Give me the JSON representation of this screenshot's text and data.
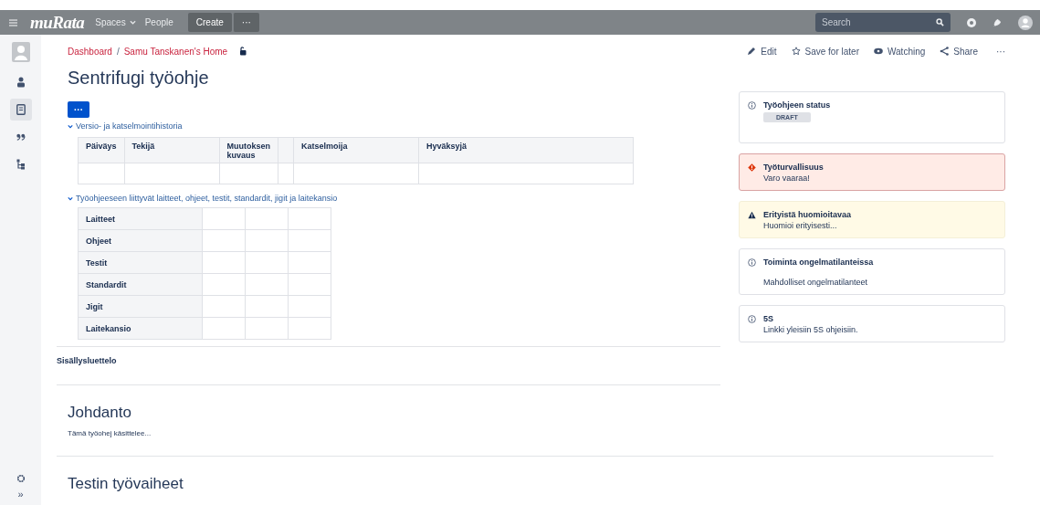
{
  "top_bar": {
    "logo": "muRata",
    "nav": [
      {
        "label": "Spaces",
        "dropdown": true
      },
      {
        "label": "People",
        "dropdown": false
      }
    ],
    "create": "Create",
    "more": "···",
    "search": {
      "placeholder": "Search"
    }
  },
  "sidebar": {
    "items": [
      {
        "kind": "person",
        "selected": false
      },
      {
        "kind": "page",
        "selected": true
      },
      {
        "kind": "quote",
        "selected": false
      },
      {
        "kind": "tree",
        "selected": false
      }
    ],
    "expand": "»"
  },
  "breadcrumb": {
    "separator": "/",
    "items": [
      "Dashboard",
      "Samu Tanskanen's Home"
    ]
  },
  "actions": [
    {
      "kind": "edit",
      "label": "Edit"
    },
    {
      "kind": "star",
      "label": "Save for later"
    },
    {
      "kind": "eye",
      "label": "Watching"
    },
    {
      "kind": "share",
      "label": "Share"
    },
    {
      "kind": "more",
      "label": "···"
    }
  ],
  "title": "Sentrifugi työohje",
  "macro_button": "···",
  "history": {
    "label": "Versio- ja katselmointihistoria",
    "expanded": true,
    "columns": [
      "Päiväys",
      "Tekijä",
      "Muutoksen kuvaus",
      "",
      "Katselmoija",
      "Hyväksyjä"
    ]
  },
  "related": {
    "label": "Työohjeeseen liittyvät laitteet, ohjeet, testit, standardit, jigit ja laitekansio",
    "expanded": true,
    "rows": [
      "Laitteet",
      "Ohjeet",
      "Testit",
      "Standardit",
      "Jigit",
      "Laitekansio"
    ]
  },
  "toc": "Sisällysluettelo",
  "sections": [
    {
      "heading": "Johdanto",
      "text": "Tämä työohej käsittelee..."
    },
    {
      "heading": "Testin työvaiheet"
    }
  ],
  "panels": [
    {
      "kind": "info",
      "title": "Työohjeen status",
      "badge": "DRAFT"
    },
    {
      "kind": "error",
      "title": "Työturvallisuus",
      "text": "Varo vaaraa!"
    },
    {
      "kind": "warning",
      "title": "Erityistä huomioitavaa",
      "text": "Huomioi erityisesti..."
    },
    {
      "kind": "info",
      "title": "Toiminta ongelmatilanteissa",
      "text": "Mahdolliset ongelmatilanteet"
    },
    {
      "kind": "info",
      "title": "5S",
      "text": "Linkki yleisiin 5S ohjeisiin."
    }
  ]
}
